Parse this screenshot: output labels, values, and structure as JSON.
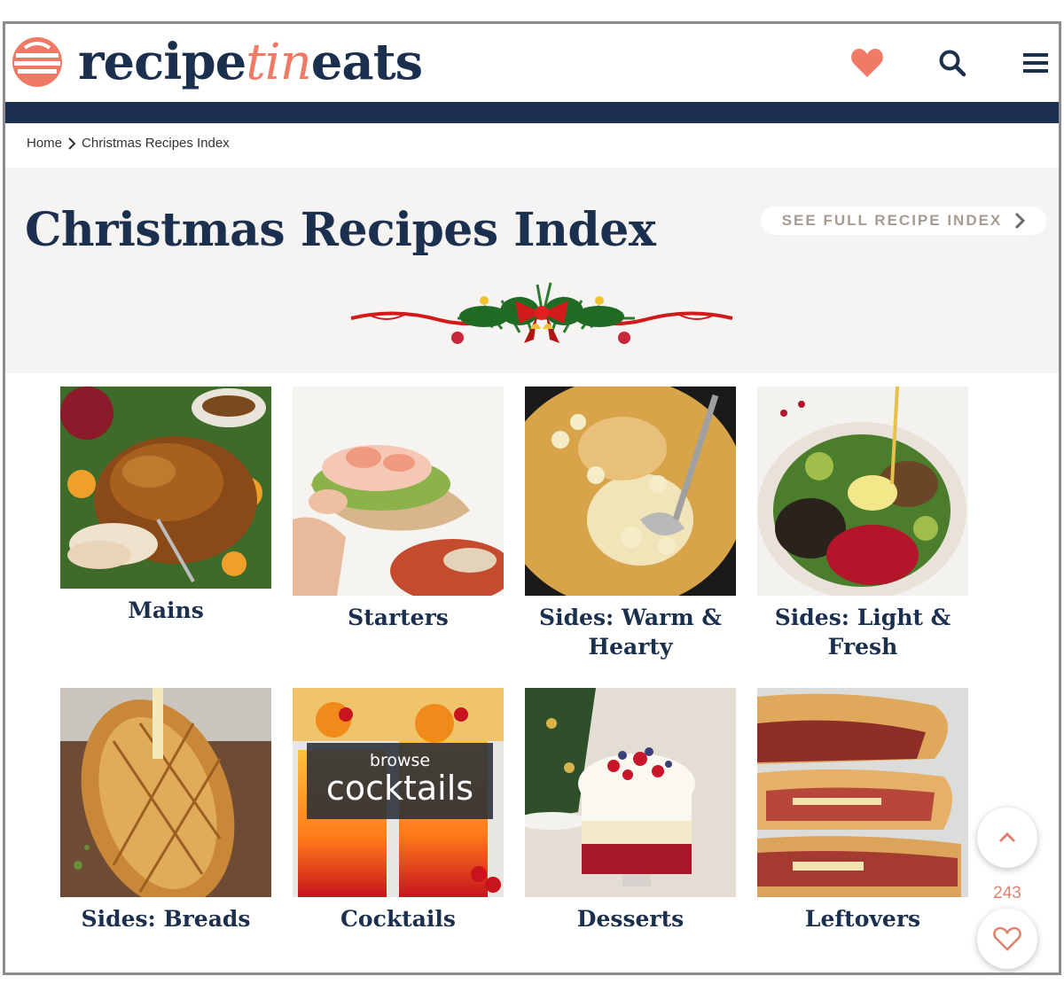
{
  "header": {
    "logo": {
      "part1": "recipe",
      "part2": "tin",
      "part3": "eats"
    },
    "icons": [
      "heart-icon",
      "search-icon",
      "menu-icon"
    ],
    "colors": {
      "navy": "#1c3052",
      "coral": "#f07a66"
    }
  },
  "breadcrumb": {
    "home": "Home",
    "current": "Christmas Recipes Index"
  },
  "hero": {
    "title": "Christmas Recipes Index",
    "full_index_label": "SEE FULL RECIPE INDEX"
  },
  "categories": [
    {
      "label": "Mains"
    },
    {
      "label": "Starters"
    },
    {
      "label": "Sides: Warm & Hearty"
    },
    {
      "label": "Sides: Light & Fresh"
    },
    {
      "label": "Sides: Breads"
    },
    {
      "label": "Cocktails",
      "overlay_small": "browse",
      "overlay_big": "cocktails"
    },
    {
      "label": "Desserts"
    },
    {
      "label": "Leftovers"
    }
  ],
  "floating": {
    "like_count": "243"
  }
}
